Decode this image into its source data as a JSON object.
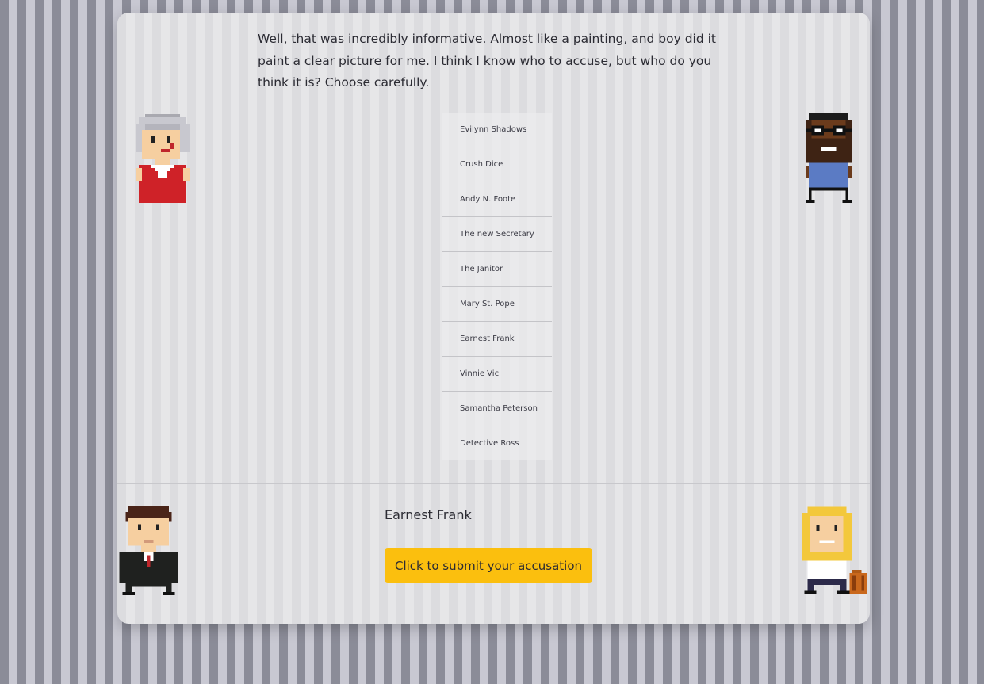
{
  "intro": {
    "text": "Well, that was incredibly informative. Almost like a painting, and boy did it paint a clear picture for me. I think I know who to accuse, but who do you think it is? Choose carefully."
  },
  "suspects": [
    "Evilynn Shadows",
    "Crush Dice",
    "Andy N. Foote",
    "The new Secretary",
    "The Janitor",
    "Mary St. Pope",
    "Earnest Frank",
    "Vinnie Vici",
    "Samantha Peterson",
    "Detective Ross"
  ],
  "selection": {
    "name": "Earnest Frank"
  },
  "submit": {
    "label": "Click to submit your accusation"
  },
  "colors": {
    "accent": "#fbbf0e",
    "text": "#2b2b33"
  },
  "avatars": [
    "grey-haired-woman-red-dress",
    "bearded-man-glasses-blue-shirt",
    "man-black-suit-red-tie",
    "blonde-woman-with-suitcase"
  ]
}
